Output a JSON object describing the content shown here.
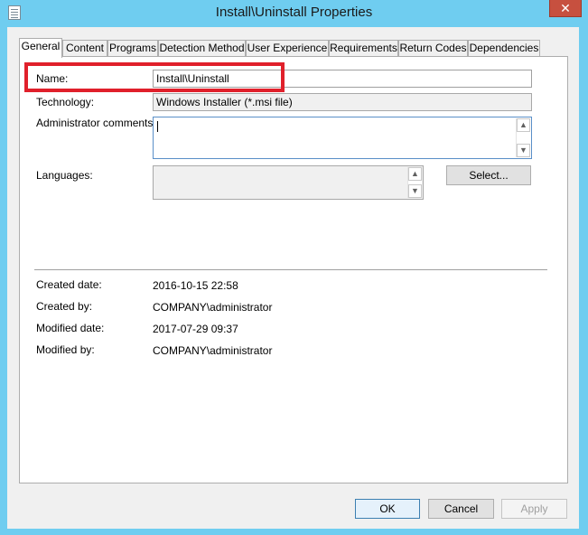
{
  "window": {
    "title": "Install\\Uninstall Properties",
    "close_glyph": "✕"
  },
  "tabs": [
    {
      "label": "General",
      "active": true
    },
    {
      "label": "Content",
      "active": false
    },
    {
      "label": "Programs",
      "active": false
    },
    {
      "label": "Detection Method",
      "active": false
    },
    {
      "label": "User Experience",
      "active": false
    },
    {
      "label": "Requirements",
      "active": false
    },
    {
      "label": "Return Codes",
      "active": false
    },
    {
      "label": "Dependencies",
      "active": false
    }
  ],
  "general": {
    "name_label": "Name:",
    "name_value": "Install\\Uninstall",
    "technology_label": "Technology:",
    "technology_value": "Windows Installer (*.msi file)",
    "admin_comments_label": "Administrator comments:",
    "admin_comments_value": "",
    "languages_label": "Languages:",
    "select_button": "Select...",
    "created_date_label": "Created date:",
    "created_date_value": "2016-10-15 22:58",
    "created_by_label": "Created by:",
    "created_by_value": "COMPANY\\administrator",
    "modified_date_label": "Modified date:",
    "modified_date_value": "2017-07-29 09:37",
    "modified_by_label": "Modified by:",
    "modified_by_value": "COMPANY\\administrator"
  },
  "footer": {
    "ok": "OK",
    "cancel": "Cancel",
    "apply": "Apply"
  },
  "scroll_glyphs": {
    "up": "▲",
    "down": "▼"
  },
  "colors": {
    "title_bar": "#6fcdf0",
    "close_button": "#c7503f",
    "highlight": "#e0202b",
    "dialog_bg": "#f0f0f0"
  },
  "icons": [
    "properties-icon",
    "close-icon",
    "scroll-up-icon",
    "scroll-down-icon"
  ]
}
